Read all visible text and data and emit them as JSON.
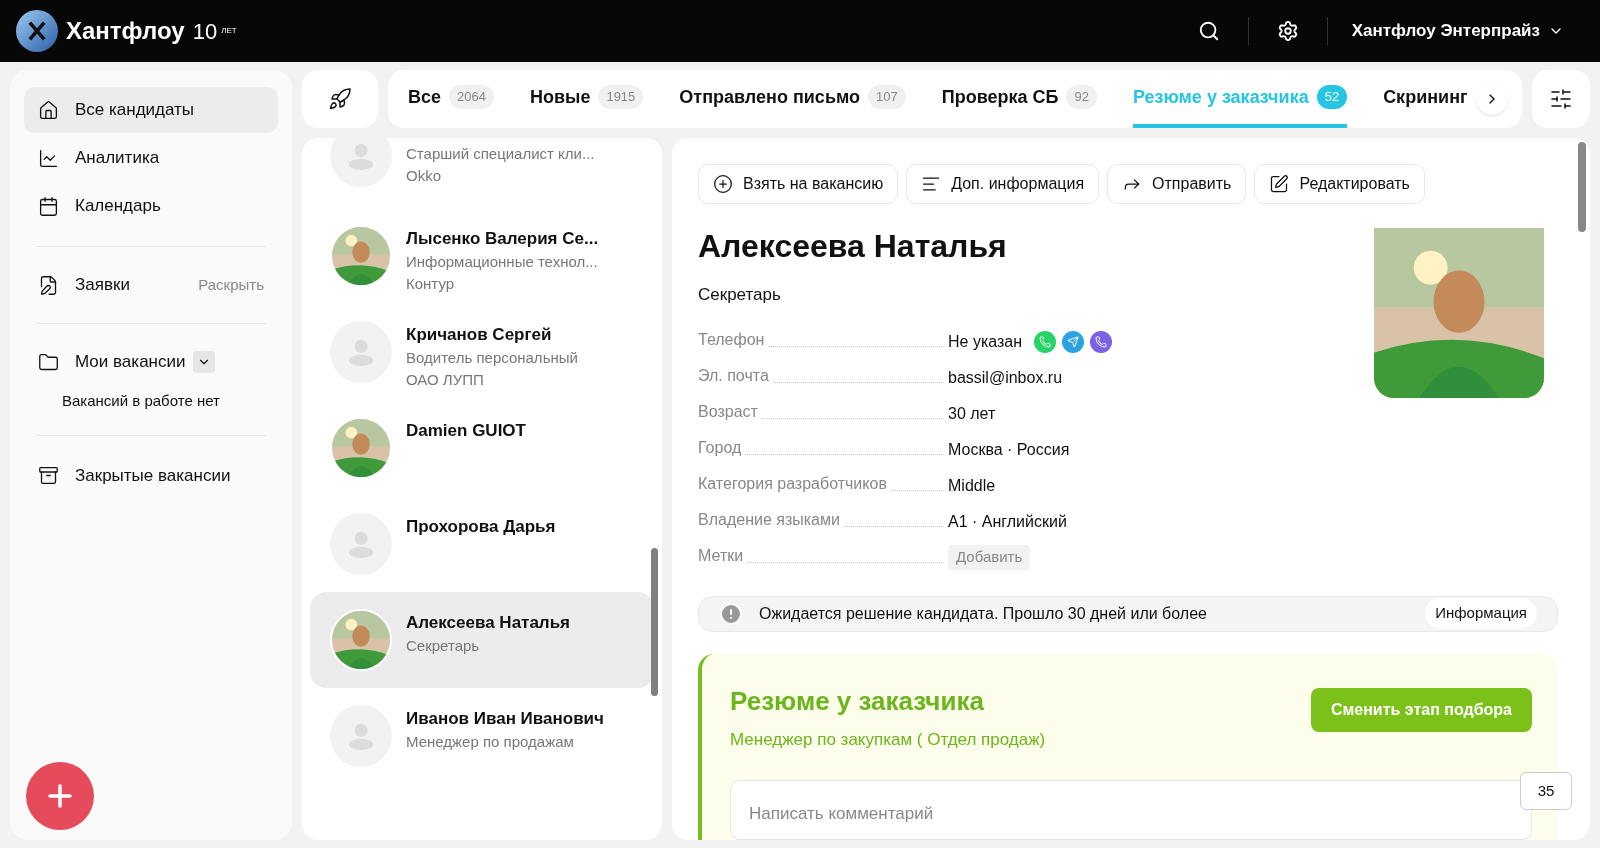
{
  "header": {
    "brand": "Хантфлоу",
    "anniversary_number": "10",
    "anniversary_word": "ЛЕТ",
    "account": "Хантфлоу Энтерпрайз"
  },
  "sidebar": {
    "items": [
      {
        "kind": "nav",
        "label": "Все кандидаты",
        "selected": true
      },
      {
        "kind": "nav",
        "label": "Аналитика",
        "selected": false
      },
      {
        "kind": "nav",
        "label": "Календарь",
        "selected": false
      },
      {
        "kind": "divider"
      },
      {
        "kind": "expand",
        "label": "Заявки",
        "action": "Раскрыть"
      },
      {
        "kind": "divider"
      },
      {
        "kind": "dropdown",
        "label": "Мои вакансии",
        "expanded": false
      },
      {
        "kind": "note",
        "label": "Вакансий в работе нет"
      },
      {
        "kind": "divider"
      },
      {
        "kind": "nav",
        "label": "Закрытые вакансии",
        "selected": false
      }
    ]
  },
  "tabs": [
    {
      "label": "Все",
      "count": "2064",
      "selected": false
    },
    {
      "label": "Новые",
      "count": "1915",
      "selected": false
    },
    {
      "label": "Отправлено письмо",
      "count": "107",
      "selected": false
    },
    {
      "label": "Проверка СБ",
      "count": "92",
      "selected": false
    },
    {
      "label": "Резюме у заказчика",
      "count": "52",
      "selected": true
    },
    {
      "label": "Скрининг",
      "selected": false
    }
  ],
  "candidates": [
    {
      "kind": "placeholder",
      "lines": [
        "Старший специалист кли...",
        "Okko"
      ],
      "selected": false
    },
    {
      "name": "Лысенко Валерия Се...",
      "lines": [
        "Информационные технол...",
        "Контур"
      ],
      "selected": false
    },
    {
      "kind": "placeholder",
      "name": "Кричанов Сергей",
      "lines": [
        "Водитель персональный",
        "ОАО ЛУПП"
      ],
      "selected": false
    },
    {
      "name": "Damien GUIOT",
      "selected": false
    },
    {
      "kind": "placeholder",
      "name": "Прохорова Дарья",
      "selected": false
    },
    {
      "name": "Алексеева Наталья",
      "lines": [
        "Секретарь"
      ],
      "selected": true
    },
    {
      "kind": "placeholder",
      "name": "Иванов Иван Иванович",
      "lines": [
        "Менеджер по продажам"
      ],
      "selected": false
    }
  ],
  "detail": {
    "actions": [
      {
        "label": "Взять на вакансию"
      },
      {
        "label": "Доп. информация"
      },
      {
        "label": "Отправить"
      },
      {
        "label": "Редактировать"
      }
    ],
    "name": "Алексеева Наталья",
    "position": "Секретарь",
    "fields": [
      {
        "kind": "phone",
        "label": "Телефон",
        "value": "Не указан"
      },
      {
        "kind": "text",
        "label": "Эл. почта",
        "value": "bassil@inbox.ru"
      },
      {
        "kind": "text",
        "label": "Возраст",
        "value": "30 лет"
      },
      {
        "kind": "text",
        "label": "Город",
        "value": "Москва · Россия"
      },
      {
        "kind": "text",
        "label": "Категория разработчиков",
        "value": "Middle"
      },
      {
        "kind": "text",
        "label": "Владение языками",
        "value": "A1 · Английский"
      },
      {
        "kind": "button",
        "label": "Метки",
        "value": "Добавить"
      }
    ],
    "alert": {
      "text": "Ожидается решение кандидата. Прошло 30 дней или более",
      "button": "Информация"
    },
    "stage": {
      "title": "Резюме у заказчика",
      "vacancy": "Менеджер по закупкам ( Отдел продаж)",
      "button": "Сменить этап подбора",
      "comment_placeholder": "Написать комментарий"
    },
    "comments_count": "35"
  }
}
